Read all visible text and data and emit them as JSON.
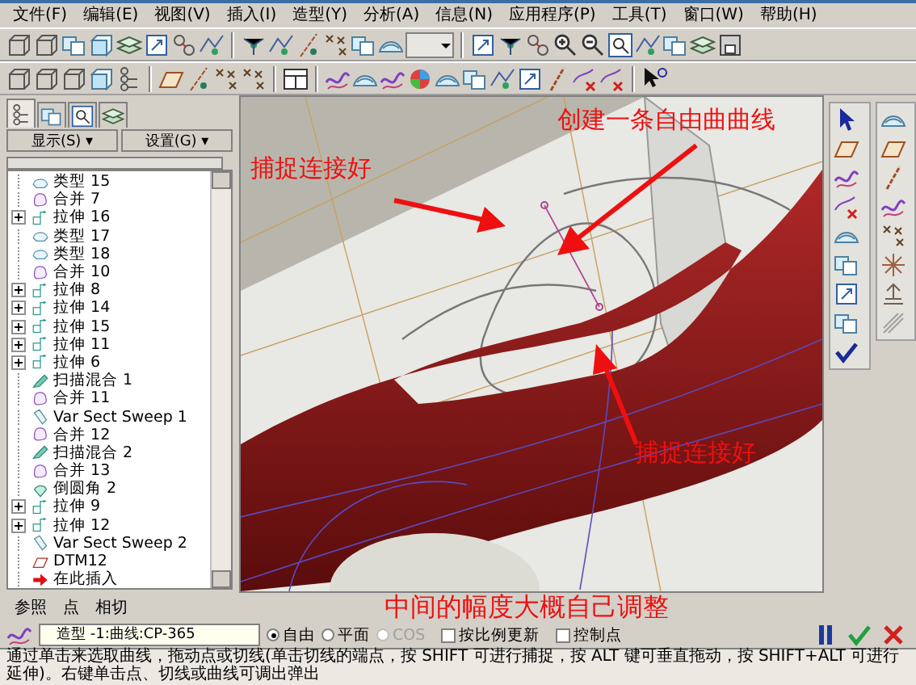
{
  "menu": [
    "文件(F)",
    "编辑(E)",
    "视图(V)",
    "插入(I)",
    "造型(Y)",
    "分析(A)",
    "信息(N)",
    "应用程序(P)",
    "工具(T)",
    "窗口(W)",
    "帮助(H)"
  ],
  "panel_tabs": [
    {
      "kind": "tree",
      "selected": true
    },
    {
      "kind": "folders",
      "selected": false
    },
    {
      "kind": "layer",
      "selected": false
    },
    {
      "kind": "templates",
      "selected": false
    }
  ],
  "panel_buttons": [
    "显示(S) ▾",
    "设置(G) ▾"
  ],
  "tree": [
    {
      "label": "类型 15",
      "kind": "style"
    },
    {
      "label": "合并 7",
      "kind": "merge"
    },
    {
      "label": "拉伸 16",
      "kind": "extrude",
      "expanded": false
    },
    {
      "label": "类型 17",
      "kind": "style"
    },
    {
      "label": "类型 18",
      "kind": "style"
    },
    {
      "label": "合并 10",
      "kind": "merge"
    },
    {
      "label": "拉伸 8",
      "kind": "extrude",
      "expanded": false
    },
    {
      "label": "拉伸 14",
      "kind": "extrude",
      "expanded": false
    },
    {
      "label": "拉伸 15",
      "kind": "extrude",
      "expanded": false
    },
    {
      "label": "拉伸 11",
      "kind": "extrude",
      "expanded": false
    },
    {
      "label": "拉伸 6",
      "kind": "extrude",
      "expanded": false
    },
    {
      "label": "扫描混合 1",
      "kind": "sweep"
    },
    {
      "label": "合并 11",
      "kind": "merge"
    },
    {
      "label": "Var Sect Sweep 1",
      "kind": "varsweep"
    },
    {
      "label": "合并 12",
      "kind": "merge"
    },
    {
      "label": "扫描混合 2",
      "kind": "sweep"
    },
    {
      "label": "合并 13",
      "kind": "merge"
    },
    {
      "label": "倒圆角 2",
      "kind": "round"
    },
    {
      "label": "拉伸 9",
      "kind": "extrude",
      "expanded": false
    },
    {
      "label": "拉伸 12",
      "kind": "extrude",
      "expanded": false
    },
    {
      "label": "Var Sect Sweep 2",
      "kind": "varsweep"
    },
    {
      "label": "DTM12",
      "kind": "datum"
    },
    {
      "label": "在此插入",
      "kind": "insert"
    }
  ],
  "annotations": [
    {
      "text": "捕捉连接好"
    },
    {
      "text": "创建一条自由曲曲线"
    },
    {
      "text": "捕捉连接好"
    },
    {
      "text": "中间的幅度大概自己调整"
    }
  ],
  "ref_tabs": [
    "参照",
    "点",
    "相切"
  ],
  "curve_field": {
    "value": "造型 -1:曲线:CP-365"
  },
  "modes": [
    {
      "label": "自由",
      "selected": true,
      "disabled": false
    },
    {
      "label": "平面",
      "selected": false,
      "disabled": false
    },
    {
      "label": "COS",
      "selected": false,
      "disabled": true
    }
  ],
  "options": [
    {
      "label": "按比例更新",
      "checked": false
    },
    {
      "label": "控制点",
      "checked": false
    }
  ],
  "status": "通过单击来选取曲线，拖动点或切线(单击切线的端点，按 SHIFT 可进行捕捉，按 ALT 键可垂直拖动，按 SHIFT+ALT 可进行延伸)。右键单击点、切线或曲线可调出弹出"
}
